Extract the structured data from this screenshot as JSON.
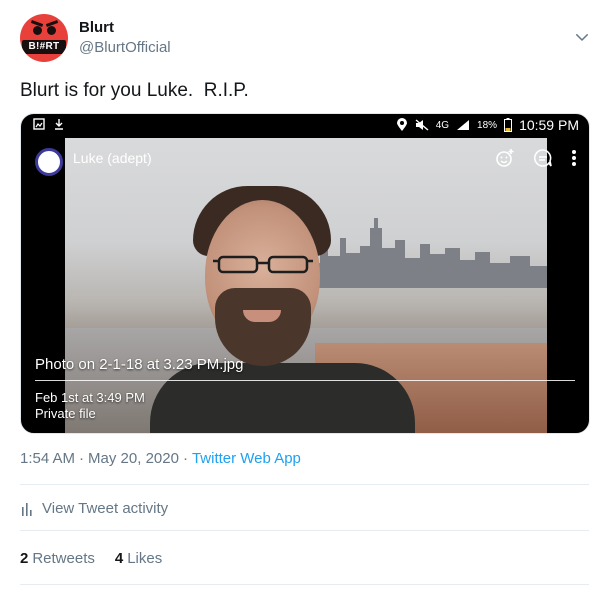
{
  "author": {
    "name": "Blurt",
    "handle": "@BlurtOfficial",
    "avatar_text": "B!#RT",
    "avatar_color": "#e8413c"
  },
  "tweet": {
    "text": "Blurt is for you Luke.  R.I.P."
  },
  "media": {
    "status_bar": {
      "network": "4G",
      "battery": "18%",
      "time": "10:59 PM"
    },
    "app_bar": {
      "title": "Luke (adept)"
    },
    "file_name": "Photo on 2-1-18 at 3.23 PM.jpg",
    "file_date": "Feb 1st at 3:49 PM",
    "file_privacy": "Private file"
  },
  "meta": {
    "time": "1:54 AM",
    "separator": "·",
    "date": "May 20, 2020",
    "source": "Twitter Web App"
  },
  "activity": {
    "label": "View Tweet activity"
  },
  "stats": {
    "retweets_count": "2",
    "retweets_label": "Retweets",
    "likes_count": "4",
    "likes_label": "Likes"
  },
  "colors": {
    "link": "#1da1f2",
    "secondary_text": "#657786",
    "primary_text": "#14171a"
  }
}
